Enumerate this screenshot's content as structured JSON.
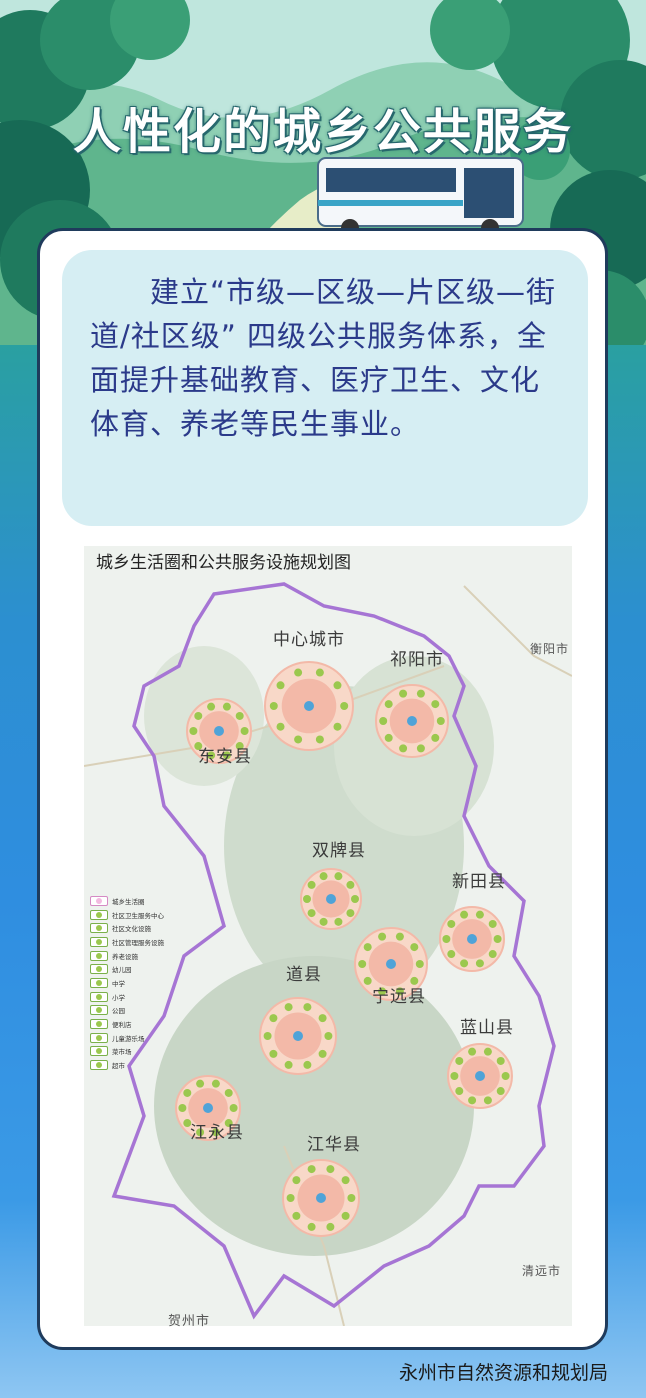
{
  "header": {
    "title": "人性化的城乡公共服务"
  },
  "intro": {
    "text": "建立“市级—区级—片区级—街道/社区级” 四级公共服务体系，全面提升基础教育、医疗卫生、文化体育、养老等民生事业。"
  },
  "map": {
    "title": "城乡生活圈和公共服务设施规划图",
    "counties": [
      {
        "name": "中心城市"
      },
      {
        "name": "祁阳市"
      },
      {
        "name": "东安县"
      },
      {
        "name": "双牌县"
      },
      {
        "name": "新田县"
      },
      {
        "name": "宁远县"
      },
      {
        "name": "道县"
      },
      {
        "name": "蓝山县"
      },
      {
        "name": "江永县"
      },
      {
        "name": "江华县"
      }
    ],
    "outside_places": {
      "hengyang": "衡阳市",
      "hezhou": "贺州市",
      "qingyuan": "清远市"
    },
    "legend": [
      {
        "label": "城乡生活圈"
      },
      {
        "label": "社区卫生服务中心"
      },
      {
        "label": "社区文化设施"
      },
      {
        "label": "社区管理服务设施"
      },
      {
        "label": "养老设施"
      },
      {
        "label": "幼儿园"
      },
      {
        "label": "中学"
      },
      {
        "label": "小学"
      },
      {
        "label": "公园"
      },
      {
        "label": "便利店"
      },
      {
        "label": "儿童游乐场"
      },
      {
        "label": "菜市场"
      },
      {
        "label": "超市"
      }
    ],
    "colors": {
      "boundary": "#a675d4",
      "circle_outer": "#f8d8c8",
      "circle_inner": "#f3b9a8",
      "facility": "#9bc84e"
    }
  },
  "footer": {
    "agency": "永州市自然资源和规划局"
  }
}
